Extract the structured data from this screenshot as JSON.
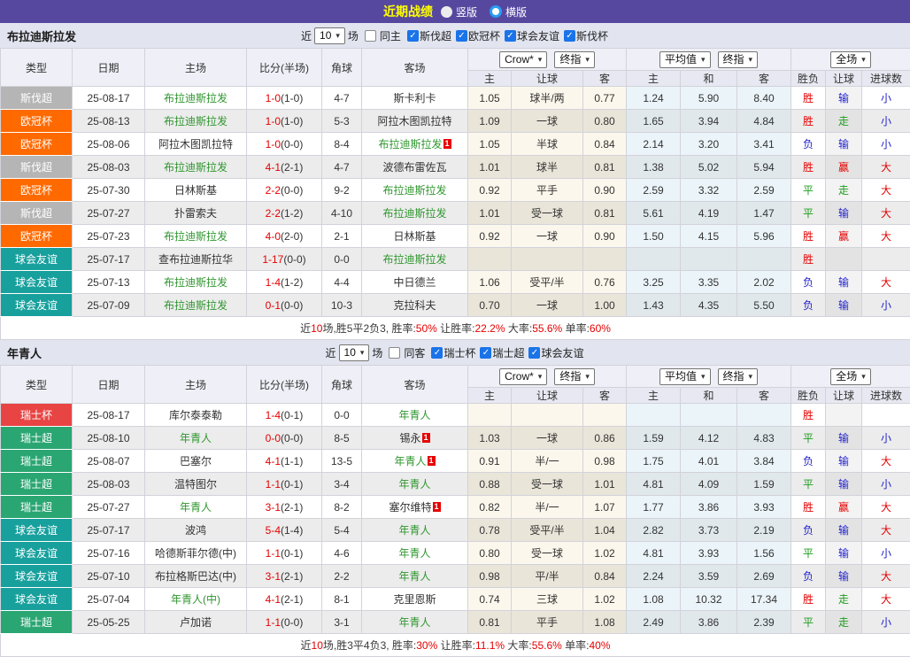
{
  "topbar": {
    "title": "近期战绩",
    "radio_vertical": "竖版",
    "radio_horizontal": "横版",
    "selected_mode": "横版"
  },
  "columns": {
    "type": "类型",
    "date": "日期",
    "home": "主场",
    "score": "比分(半场)",
    "corner": "角球",
    "away": "客场"
  },
  "selects": {
    "bookmaker": "Crow*",
    "bookmaker_final": "终指",
    "average": "平均值",
    "average_final": "终指",
    "fulltime": "全场"
  },
  "subcols": {
    "crow_home": "主",
    "crow_handicap": "让球",
    "crow_away": "客",
    "avg_home": "主",
    "avg_draw": "和",
    "avg_away": "客",
    "result_wdl": "胜负",
    "result_handicap": "让球",
    "result_goals": "进球数"
  },
  "result_colors": {
    "胜": "red",
    "平": "grn",
    "负": "blue",
    "赢": "red",
    "走": "grn",
    "输": "blue",
    "大": "red",
    "小": "blue"
  },
  "colors": {
    "topbar_purple": "#57489f",
    "title_yellow": "#ffff00",
    "team_green": "#2f962f",
    "score_red": "#e60000",
    "checkbox_blue": "#1a73e8",
    "league": {
      "斯伐超": "#b5b5b5",
      "欧冠杯": "#ff6a00",
      "球会友谊": "#18a09d",
      "瑞士杯": "#e84444",
      "瑞士超": "#2aa672"
    }
  },
  "sections": [
    {
      "team": "布拉迪斯拉发",
      "filter": {
        "near": "近",
        "count": "10",
        "matches": "场",
        "same": "同主",
        "leagues": [
          "斯伐超",
          "欧冠杯",
          "球会友谊",
          "斯伐杯"
        ]
      },
      "rows": [
        {
          "league": "斯伐超",
          "date": "25-08-17",
          "home": "布拉迪斯拉发",
          "home_green": true,
          "home_badge": false,
          "score": "1-0",
          "half": "(1-0)",
          "corner": "4-7",
          "away": "斯卡利卡",
          "away_green": false,
          "away_badge": false,
          "crow": [
            "1.05",
            "球半/两",
            "0.77"
          ],
          "avg": [
            "1.24",
            "5.90",
            "8.40"
          ],
          "res": [
            "胜",
            "输",
            "小"
          ]
        },
        {
          "league": "欧冠杯",
          "date": "25-08-13",
          "home": "布拉迪斯拉发",
          "home_green": true,
          "home_badge": false,
          "score": "1-0",
          "half": "(1-0)",
          "corner": "5-3",
          "away": "阿拉木图凯拉特",
          "away_green": false,
          "away_badge": false,
          "crow": [
            "1.09",
            "一球",
            "0.80"
          ],
          "avg": [
            "1.65",
            "3.94",
            "4.84"
          ],
          "res": [
            "胜",
            "走",
            "小"
          ]
        },
        {
          "league": "欧冠杯",
          "date": "25-08-06",
          "home": "阿拉木图凯拉特",
          "home_green": false,
          "home_badge": false,
          "score": "1-0",
          "half": "(0-0)",
          "corner": "8-4",
          "away": "布拉迪斯拉发",
          "away_green": true,
          "away_badge": true,
          "crow": [
            "1.05",
            "半球",
            "0.84"
          ],
          "avg": [
            "2.14",
            "3.20",
            "3.41"
          ],
          "res": [
            "负",
            "输",
            "小"
          ]
        },
        {
          "league": "斯伐超",
          "date": "25-08-03",
          "home": "布拉迪斯拉发",
          "home_green": true,
          "home_badge": false,
          "score": "4-1",
          "half": "(2-1)",
          "corner": "4-7",
          "away": "波德布雷佐瓦",
          "away_green": false,
          "away_badge": false,
          "crow": [
            "1.01",
            "球半",
            "0.81"
          ],
          "avg": [
            "1.38",
            "5.02",
            "5.94"
          ],
          "res": [
            "胜",
            "赢",
            "大"
          ]
        },
        {
          "league": "欧冠杯",
          "date": "25-07-30",
          "home": "日林斯基",
          "home_green": false,
          "home_badge": false,
          "score": "2-2",
          "half": "(0-0)",
          "corner": "9-2",
          "away": "布拉迪斯拉发",
          "away_green": true,
          "away_badge": false,
          "crow": [
            "0.92",
            "平手",
            "0.90"
          ],
          "avg": [
            "2.59",
            "3.32",
            "2.59"
          ],
          "res": [
            "平",
            "走",
            "大"
          ]
        },
        {
          "league": "斯伐超",
          "date": "25-07-27",
          "home": "扑雷索夫",
          "home_green": false,
          "home_badge": false,
          "score": "2-2",
          "half": "(1-2)",
          "corner": "4-10",
          "away": "布拉迪斯拉发",
          "away_green": true,
          "away_badge": false,
          "crow": [
            "1.01",
            "受一球",
            "0.81"
          ],
          "avg": [
            "5.61",
            "4.19",
            "1.47"
          ],
          "res": [
            "平",
            "输",
            "大"
          ]
        },
        {
          "league": "欧冠杯",
          "date": "25-07-23",
          "home": "布拉迪斯拉发",
          "home_green": true,
          "home_badge": false,
          "score": "4-0",
          "half": "(2-0)",
          "corner": "2-1",
          "away": "日林斯基",
          "away_green": false,
          "away_badge": false,
          "crow": [
            "0.92",
            "一球",
            "0.90"
          ],
          "avg": [
            "1.50",
            "4.15",
            "5.96"
          ],
          "res": [
            "胜",
            "赢",
            "大"
          ]
        },
        {
          "league": "球会友谊",
          "date": "25-07-17",
          "home": "查布拉迪斯拉华",
          "home_green": false,
          "home_badge": false,
          "score": "1-17",
          "half": "(0-0)",
          "corner": "0-0",
          "away": "布拉迪斯拉发",
          "away_green": true,
          "away_badge": false,
          "crow": [
            "",
            "",
            ""
          ],
          "avg": [
            "",
            "",
            ""
          ],
          "res": [
            "胜",
            "",
            ""
          ]
        },
        {
          "league": "球会友谊",
          "date": "25-07-13",
          "home": "布拉迪斯拉发",
          "home_green": true,
          "home_badge": false,
          "score": "1-4",
          "half": "(1-2)",
          "corner": "4-4",
          "away": "中日德兰",
          "away_green": false,
          "away_badge": false,
          "crow": [
            "1.06",
            "受平/半",
            "0.76"
          ],
          "avg": [
            "3.25",
            "3.35",
            "2.02"
          ],
          "res": [
            "负",
            "输",
            "大"
          ]
        },
        {
          "league": "球会友谊",
          "date": "25-07-09",
          "home": "布拉迪斯拉发",
          "home_green": true,
          "home_badge": false,
          "score": "0-1",
          "half": "(0-0)",
          "corner": "10-3",
          "away": "克拉科夫",
          "away_green": false,
          "away_badge": false,
          "crow": [
            "0.70",
            "一球",
            "1.00"
          ],
          "avg": [
            "1.43",
            "4.35",
            "5.50"
          ],
          "res": [
            "负",
            "输",
            "小"
          ]
        }
      ],
      "summary": [
        {
          "t": "近"
        },
        {
          "t": "10",
          "red": true
        },
        {
          "t": "场,胜5平2负3, 胜率:"
        },
        {
          "t": "50%",
          "red": true
        },
        {
          "t": " 让胜率:"
        },
        {
          "t": "22.2%",
          "red": true
        },
        {
          "t": " 大率:"
        },
        {
          "t": "55.6%",
          "red": true
        },
        {
          "t": " 单率:"
        },
        {
          "t": "60%",
          "red": true
        }
      ]
    },
    {
      "team": "年青人",
      "filter": {
        "near": "近",
        "count": "10",
        "matches": "场",
        "same": "同客",
        "leagues": [
          "瑞士杯",
          "瑞士超",
          "球会友谊"
        ]
      },
      "rows": [
        {
          "league": "瑞士杯",
          "date": "25-08-17",
          "home": "库尔泰泰勒",
          "home_green": false,
          "home_badge": false,
          "score": "1-4",
          "half": "(0-1)",
          "corner": "0-0",
          "away": "年青人",
          "away_green": true,
          "away_badge": false,
          "crow": [
            "",
            "",
            ""
          ],
          "avg": [
            "",
            "",
            ""
          ],
          "res": [
            "胜",
            "",
            ""
          ]
        },
        {
          "league": "瑞士超",
          "date": "25-08-10",
          "home": "年青人",
          "home_green": true,
          "home_badge": false,
          "score": "0-0",
          "half": "(0-0)",
          "corner": "8-5",
          "away": "锡永",
          "away_green": false,
          "away_badge": true,
          "crow": [
            "1.03",
            "一球",
            "0.86"
          ],
          "avg": [
            "1.59",
            "4.12",
            "4.83"
          ],
          "res": [
            "平",
            "输",
            "小"
          ]
        },
        {
          "league": "瑞士超",
          "date": "25-08-07",
          "home": "巴塞尔",
          "home_green": false,
          "home_badge": false,
          "score": "4-1",
          "half": "(1-1)",
          "corner": "13-5",
          "away": "年青人",
          "away_green": true,
          "away_badge": true,
          "crow": [
            "0.91",
            "半/一",
            "0.98"
          ],
          "avg": [
            "1.75",
            "4.01",
            "3.84"
          ],
          "res": [
            "负",
            "输",
            "大"
          ]
        },
        {
          "league": "瑞士超",
          "date": "25-08-03",
          "home": "温特图尔",
          "home_green": false,
          "home_badge": false,
          "score": "1-1",
          "half": "(0-1)",
          "corner": "3-4",
          "away": "年青人",
          "away_green": true,
          "away_badge": false,
          "crow": [
            "0.88",
            "受一球",
            "1.01"
          ],
          "avg": [
            "4.81",
            "4.09",
            "1.59"
          ],
          "res": [
            "平",
            "输",
            "小"
          ]
        },
        {
          "league": "瑞士超",
          "date": "25-07-27",
          "home": "年青人",
          "home_green": true,
          "home_badge": false,
          "score": "3-1",
          "half": "(2-1)",
          "corner": "8-2",
          "away": "塞尔维特",
          "away_green": false,
          "away_badge": true,
          "crow": [
            "0.82",
            "半/一",
            "1.07"
          ],
          "avg": [
            "1.77",
            "3.86",
            "3.93"
          ],
          "res": [
            "胜",
            "赢",
            "大"
          ]
        },
        {
          "league": "球会友谊",
          "date": "25-07-17",
          "home": "波鸿",
          "home_green": false,
          "home_badge": false,
          "score": "5-4",
          "half": "(1-4)",
          "corner": "5-4",
          "away": "年青人",
          "away_green": true,
          "away_badge": false,
          "crow": [
            "0.78",
            "受平/半",
            "1.04"
          ],
          "avg": [
            "2.82",
            "3.73",
            "2.19"
          ],
          "res": [
            "负",
            "输",
            "大"
          ]
        },
        {
          "league": "球会友谊",
          "date": "25-07-16",
          "home": "哈德斯菲尔德(中)",
          "home_green": false,
          "home_badge": false,
          "score": "1-1",
          "half": "(0-1)",
          "corner": "4-6",
          "away": "年青人",
          "away_green": true,
          "away_badge": false,
          "crow": [
            "0.80",
            "受一球",
            "1.02"
          ],
          "avg": [
            "4.81",
            "3.93",
            "1.56"
          ],
          "res": [
            "平",
            "输",
            "小"
          ]
        },
        {
          "league": "球会友谊",
          "date": "25-07-10",
          "home": "布拉格斯巴达(中)",
          "home_green": false,
          "home_badge": false,
          "score": "3-1",
          "half": "(2-1)",
          "corner": "2-2",
          "away": "年青人",
          "away_green": true,
          "away_badge": false,
          "crow": [
            "0.98",
            "平/半",
            "0.84"
          ],
          "avg": [
            "2.24",
            "3.59",
            "2.69"
          ],
          "res": [
            "负",
            "输",
            "大"
          ]
        },
        {
          "league": "球会友谊",
          "date": "25-07-04",
          "home": "年青人(中)",
          "home_green": true,
          "home_badge": false,
          "score": "4-1",
          "half": "(2-1)",
          "corner": "8-1",
          "away": "克里恩斯",
          "away_green": false,
          "away_badge": false,
          "crow": [
            "0.74",
            "三球",
            "1.02"
          ],
          "avg": [
            "1.08",
            "10.32",
            "17.34"
          ],
          "res": [
            "胜",
            "走",
            "大"
          ]
        },
        {
          "league": "瑞士超",
          "date": "25-05-25",
          "home": "卢加诺",
          "home_green": false,
          "home_badge": false,
          "score": "1-1",
          "half": "(0-0)",
          "corner": "3-1",
          "away": "年青人",
          "away_green": true,
          "away_badge": false,
          "crow": [
            "0.81",
            "平手",
            "1.08"
          ],
          "avg": [
            "2.49",
            "3.86",
            "2.39"
          ],
          "res": [
            "平",
            "走",
            "小"
          ]
        }
      ],
      "summary": [
        {
          "t": "近"
        },
        {
          "t": "10",
          "red": true
        },
        {
          "t": "场,胜3平4负3, 胜率:"
        },
        {
          "t": "30%",
          "red": true
        },
        {
          "t": " 让胜率:"
        },
        {
          "t": "11.1%",
          "red": true
        },
        {
          "t": " 大率:"
        },
        {
          "t": "55.6%",
          "red": true
        },
        {
          "t": " 单率:"
        },
        {
          "t": "40%",
          "red": true
        }
      ]
    }
  ]
}
